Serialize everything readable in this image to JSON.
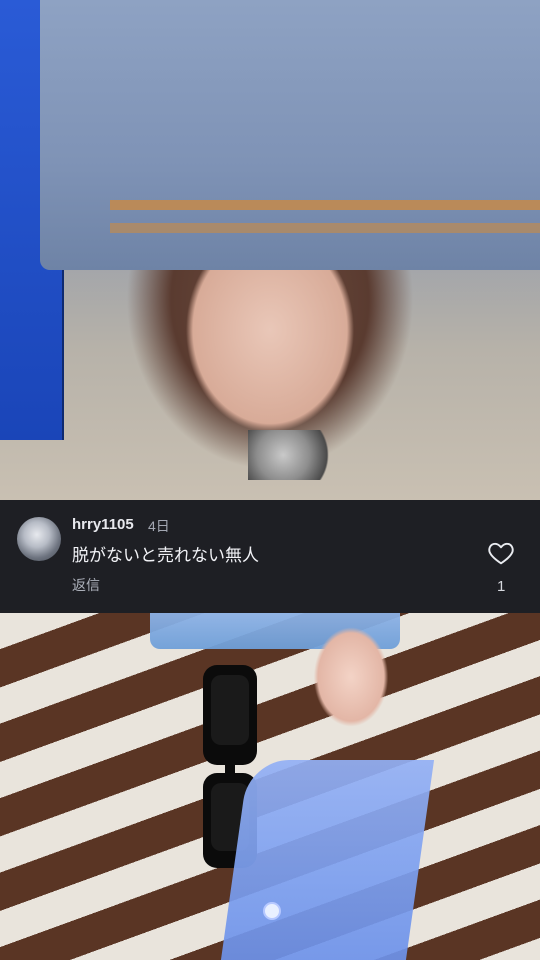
{
  "comment": {
    "username": "hrry1105",
    "time": "4日",
    "text": "脱がないと売れない無人",
    "reply_label": "返信",
    "like_count": "1",
    "icons": {
      "avatar": "avatar",
      "like": "heart-icon"
    }
  },
  "colors": {
    "card_bg": "#1e1f24",
    "text_primary": "#f1f2f6",
    "text_secondary": "#a3a7b2"
  }
}
